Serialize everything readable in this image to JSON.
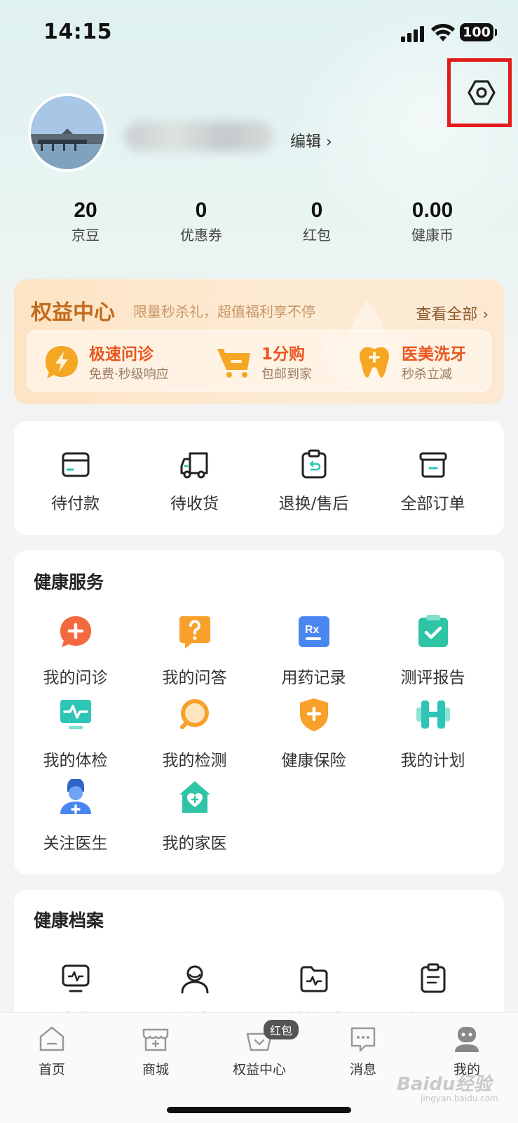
{
  "status_bar": {
    "time": "14:15",
    "battery": "100"
  },
  "profile": {
    "edit_label": "编辑 ›"
  },
  "stats": [
    {
      "value": "20",
      "label": "京豆"
    },
    {
      "value": "0",
      "label": "优惠券"
    },
    {
      "value": "0",
      "label": "红包"
    },
    {
      "value": "0.00",
      "label": "健康币"
    }
  ],
  "benefits": {
    "title": "权益中心",
    "subtitle": "限量秒杀礼，超值福利享不停",
    "view_all": "查看全部 ›",
    "items": [
      {
        "title": "极速问诊",
        "sub": "免费·秒级响应",
        "icon": "lightning-icon"
      },
      {
        "title": "1分购",
        "sub": "包邮到家",
        "icon": "cart-icon"
      },
      {
        "title": "医美洗牙",
        "sub": "秒杀立减",
        "icon": "tooth-icon"
      }
    ]
  },
  "orders": [
    {
      "label": "待付款",
      "icon": "wallet-icon"
    },
    {
      "label": "待收货",
      "icon": "truck-icon"
    },
    {
      "label": "退换/售后",
      "icon": "return-icon"
    },
    {
      "label": "全部订单",
      "icon": "box-icon"
    }
  ],
  "health_services": {
    "title": "健康服务",
    "items": [
      {
        "label": "我的问诊",
        "icon": "consult-icon",
        "color": "#f4683f"
      },
      {
        "label": "我的问答",
        "icon": "question-icon",
        "color": "#f7a12c"
      },
      {
        "label": "用药记录",
        "icon": "rx-icon",
        "color": "#4a86f0"
      },
      {
        "label": "测评报告",
        "icon": "report-check-icon",
        "color": "#2ec4a6"
      },
      {
        "label": "我的体检",
        "icon": "monitor-icon",
        "color": "#2ec4b6"
      },
      {
        "label": "我的检测",
        "icon": "search-circle-icon",
        "color": "#f7a12c"
      },
      {
        "label": "健康保险",
        "icon": "shield-icon",
        "color": "#f7a12c"
      },
      {
        "label": "我的计划",
        "icon": "dumbbell-icon",
        "color": "#2ec4b6"
      },
      {
        "label": "关注医生",
        "icon": "doctor-icon",
        "color": "#4a86f0"
      },
      {
        "label": "我的家医",
        "icon": "home-heart-icon",
        "color": "#2ec4a6"
      }
    ]
  },
  "health_records": {
    "title": "健康档案",
    "items": [
      {
        "label": "健康监测",
        "icon": "monitor-wave-icon"
      },
      {
        "label": "家庭成员",
        "icon": "person-icon"
      },
      {
        "label": "体检报告",
        "icon": "folder-wave-icon"
      },
      {
        "label": "就医记录",
        "icon": "clipboard-icon"
      }
    ]
  },
  "tab_bar": {
    "items": [
      {
        "label": "首页",
        "icon": "home-icon"
      },
      {
        "label": "商城",
        "icon": "store-icon"
      },
      {
        "label": "权益中心",
        "icon": "gift-basket-icon",
        "badge": "红包"
      },
      {
        "label": "消息",
        "icon": "message-icon"
      },
      {
        "label": "我的",
        "icon": "user-icon"
      }
    ]
  },
  "watermark": {
    "text": "Baidu经验",
    "sub": "jingyan.baidu.com"
  }
}
